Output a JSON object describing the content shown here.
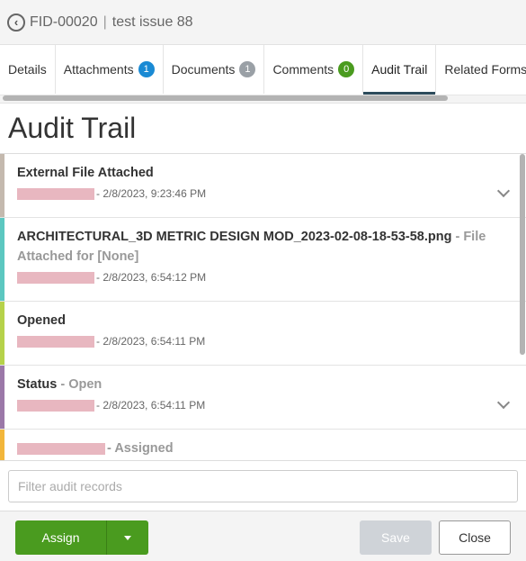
{
  "header": {
    "id": "FID-00020",
    "separator": "|",
    "title": "test issue 88"
  },
  "tabs": [
    {
      "label": "Details",
      "badge": null
    },
    {
      "label": "Attachments",
      "badge": "1",
      "badge_color": "#1a8ad4"
    },
    {
      "label": "Documents",
      "badge": "1",
      "badge_color": "#9aa0a6"
    },
    {
      "label": "Comments",
      "badge": "0",
      "badge_color": "#4a9b1f"
    },
    {
      "label": "Audit Trail",
      "badge": null,
      "active": true
    },
    {
      "label": "Related Forms",
      "badge": null
    }
  ],
  "page_title": "Audit Trail",
  "records": [
    {
      "title": "External File Attached",
      "suffix": "",
      "meta": "- 2/8/2023, 9:23:46 PM",
      "color": "#c4b9ae",
      "expandable": true
    },
    {
      "title": "ARCHITECTURAL_3D METRIC DESIGN MOD_2023-02-08-18-53-58.png",
      "suffix": "- File Attached for [None]",
      "meta": "- 2/8/2023, 6:54:12 PM",
      "color": "#5cc7c0",
      "expandable": false
    },
    {
      "title": "Opened",
      "suffix": "",
      "meta": "- 2/8/2023, 6:54:11 PM",
      "color": "#b6d24a",
      "expandable": false
    },
    {
      "title": "Status",
      "suffix": "- Open",
      "meta": "- 2/8/2023, 6:54:11 PM",
      "color": "#9b78a8",
      "expandable": true
    },
    {
      "title": "",
      "suffix": "- Assigned",
      "meta": "",
      "color": "#f2b63b",
      "expandable": false,
      "redacted_title": true
    }
  ],
  "filter": {
    "placeholder": "Filter audit records",
    "value": ""
  },
  "footer": {
    "assign_label": "Assign",
    "save_label": "Save",
    "close_label": "Close"
  }
}
